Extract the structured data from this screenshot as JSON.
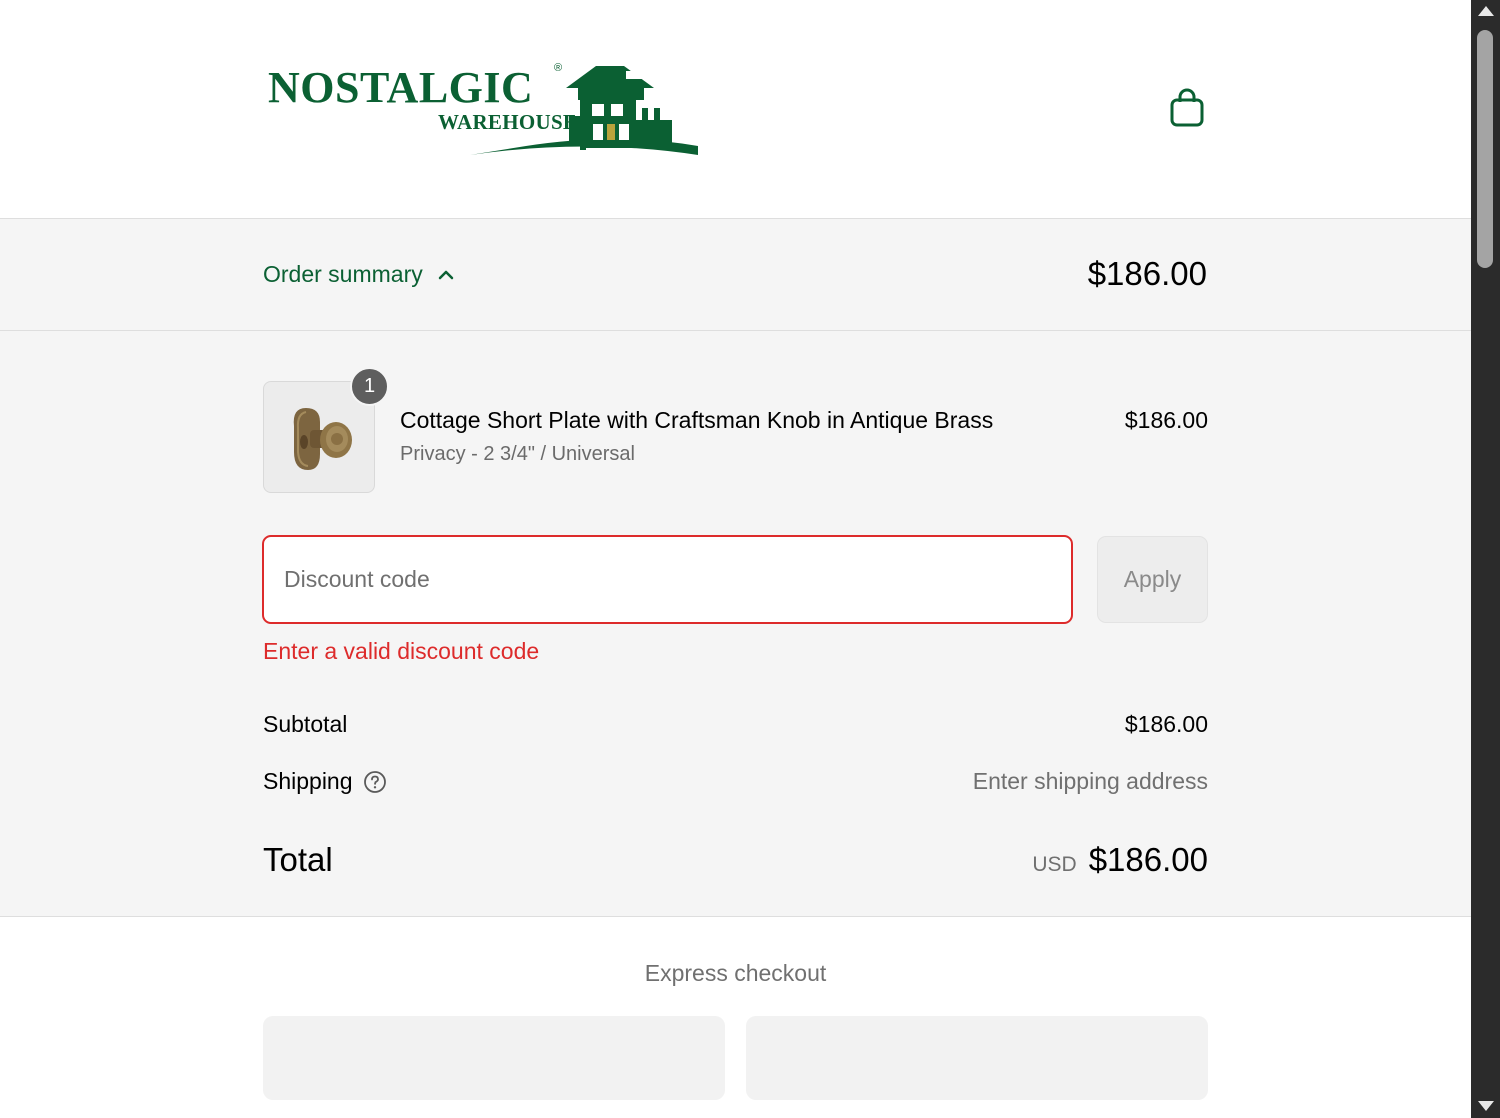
{
  "brand": {
    "name_main": "NOSTALGIC",
    "name_sub": "WAREHOUSE",
    "registered_mark": "®",
    "color": "#0b6033"
  },
  "header": {
    "cart_icon": "shopping-bag-icon"
  },
  "summary_toggle": {
    "label": "Order summary",
    "icon": "chevron-up-icon",
    "total": "$186.00"
  },
  "line_item": {
    "quantity": "1",
    "title": "Cottage Short Plate with Craftsman Knob in Antique Brass",
    "variant": "Privacy - 2 3/4\" / Universal",
    "price": "$186.00",
    "image": "door-knob-image"
  },
  "discount": {
    "placeholder": "Discount code",
    "value": "",
    "apply_label": "Apply",
    "error": "Enter a valid discount code",
    "error_color": "#dd2b2b"
  },
  "totals": {
    "subtotal_label": "Subtotal",
    "subtotal_value": "$186.00",
    "shipping_label": "Shipping",
    "shipping_help_icon": "question-circle-icon",
    "shipping_value": "Enter shipping address",
    "total_label": "Total",
    "currency": "USD",
    "total_value": "$186.00"
  },
  "express": {
    "title": "Express checkout"
  }
}
